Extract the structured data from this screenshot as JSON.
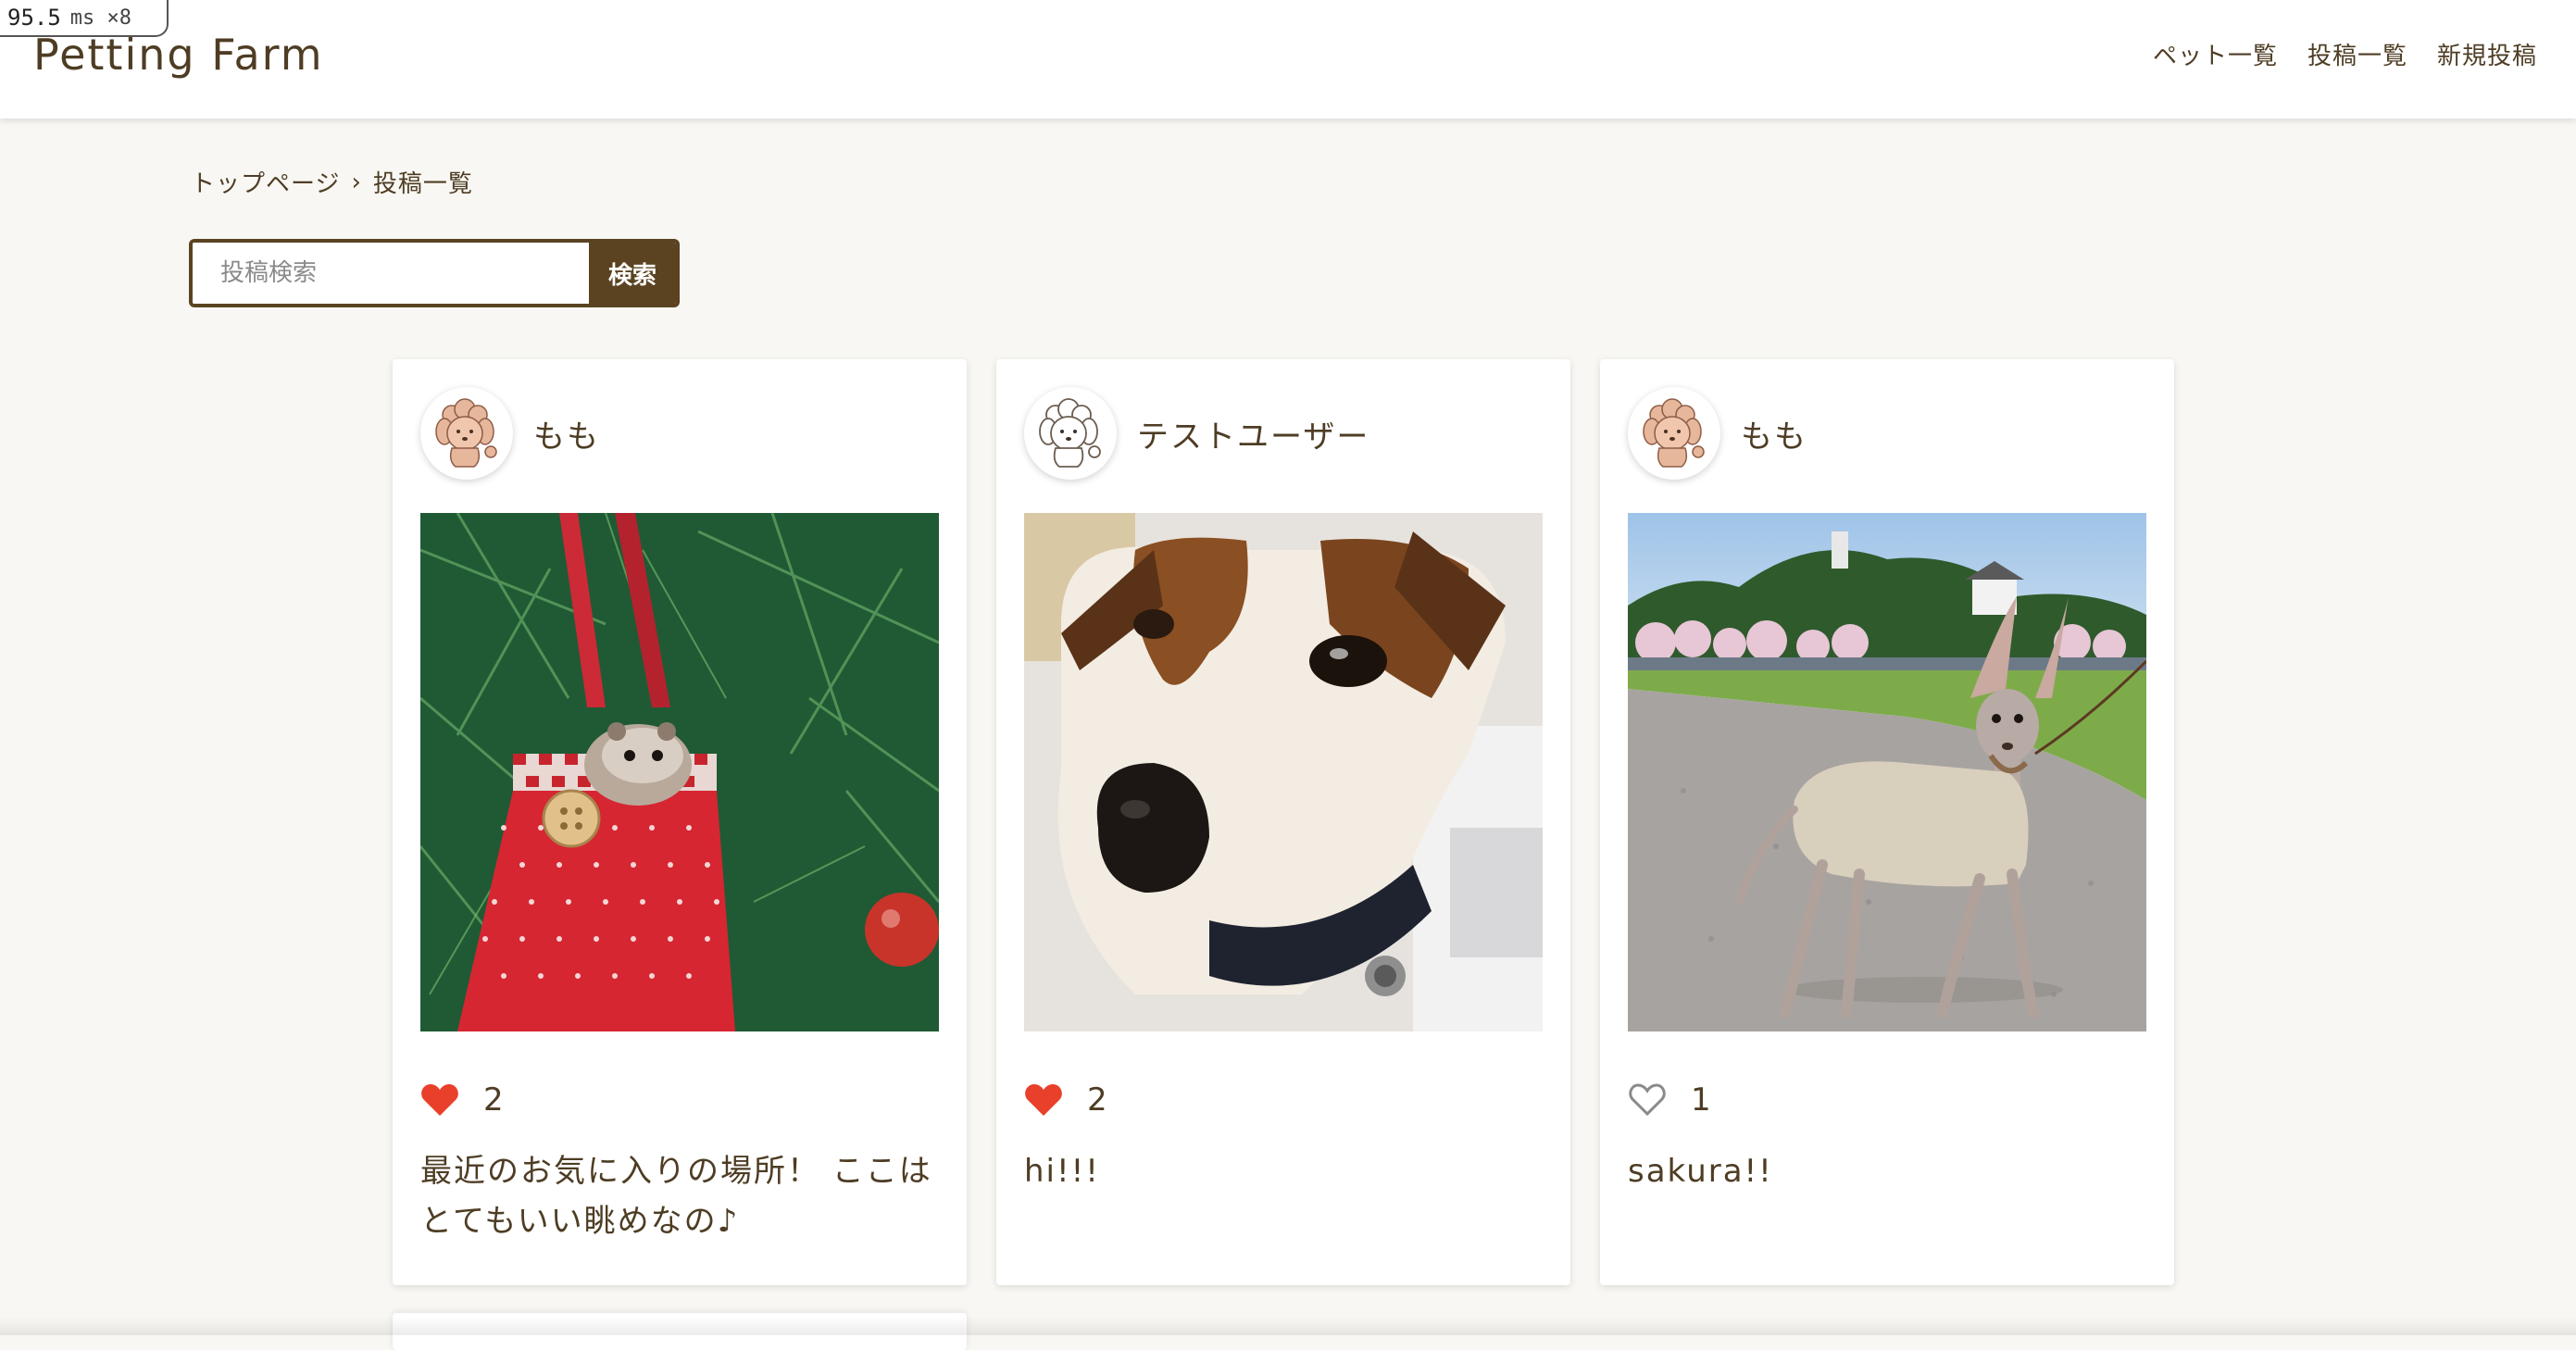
{
  "perf": {
    "value": "95.5",
    "unit": "ms ×8"
  },
  "header": {
    "logo": "Petting Farm",
    "nav": [
      {
        "label": "ペット一覧"
      },
      {
        "label": "投稿一覧"
      },
      {
        "label": "新規投稿"
      }
    ]
  },
  "breadcrumb": {
    "home": "トップページ",
    "separator": "›",
    "current": "投稿一覧"
  },
  "search": {
    "placeholder": "投稿検索",
    "button_label": "検索"
  },
  "posts": [
    {
      "author": "もも",
      "avatar_icon": "poodle-avatar-icon",
      "photo_subject": "hamster-in-christmas-bag",
      "liked": true,
      "likes": "2",
      "text": "最近のお気に入りの場所！ ここはとてもいい眺めなの♪"
    },
    {
      "author": "テストユーザー",
      "avatar_icon": "white-poodle-avatar-icon",
      "photo_subject": "jack-russell-closeup",
      "liked": true,
      "likes": "2",
      "text": "hi!!!"
    },
    {
      "author": "もも",
      "avatar_icon": "poodle-avatar-icon",
      "photo_subject": "italian-greyhound-walk",
      "liked": false,
      "likes": "1",
      "text": "sakura!!"
    }
  ],
  "colors": {
    "brand": "#4e3d24",
    "button": "#5b4322",
    "background": "#f8f7f3",
    "heart": "#e8402a"
  }
}
